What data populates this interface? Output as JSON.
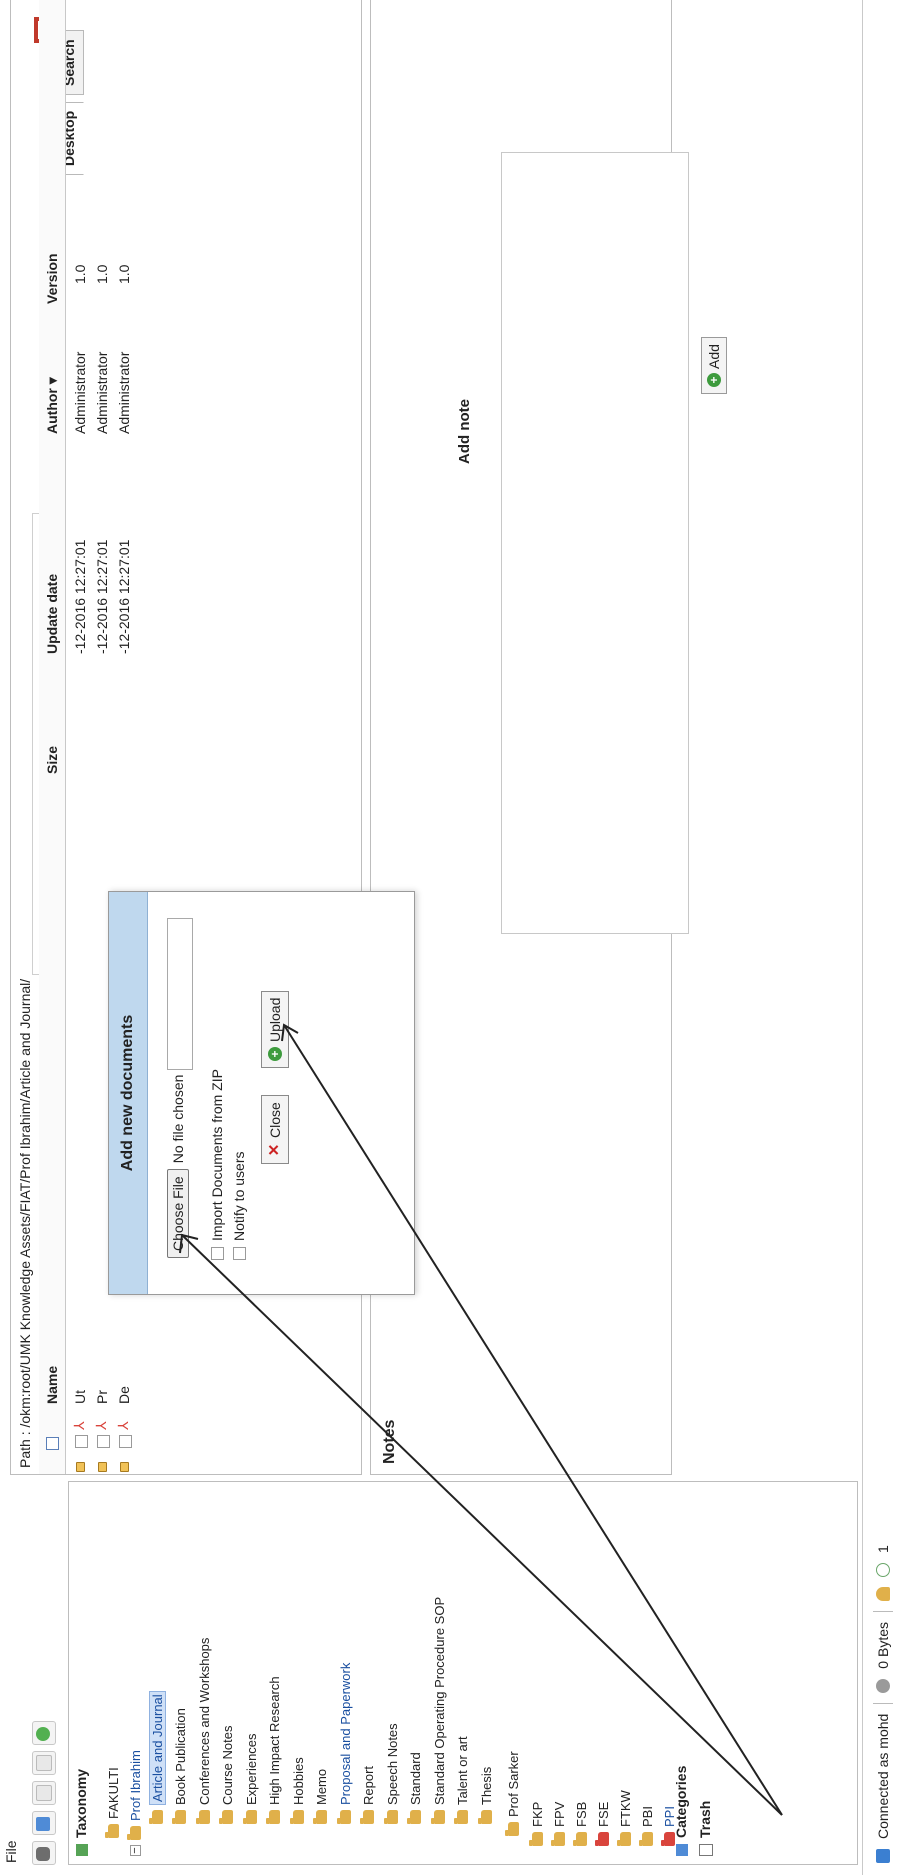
{
  "menu": {
    "file_label": "File"
  },
  "toolbar": {
    "tabs": [
      {
        "label": "Desktop"
      },
      {
        "label": "Search"
      }
    ]
  },
  "sidebar": {
    "taxonomy_label": "Taxonomy",
    "tree": {
      "fakulti": "FAKULTI",
      "prof_ibrahim": "Prof Ibrahim",
      "children": [
        "Article and Journal",
        "Book Publication",
        "Conferences and Workshops",
        "Course Notes",
        "Experiences",
        "High Impact Research",
        "Hobbies",
        "Memo",
        "Proposal and Paperwork",
        "Report",
        "Speech Notes",
        "Standard",
        "Standard Operating Procedure SOP",
        "Talent or art",
        "Thesis"
      ],
      "prof_sarker": "Prof Sarker",
      "faculties": [
        "FKP",
        "FPV",
        "FSB",
        "FSE",
        "FTKW",
        "PBI",
        "PPI"
      ]
    },
    "categories_label": "Categories",
    "trash_label": "Trash"
  },
  "status": {
    "connected": "Connected as mohd",
    "bytes": "0 Bytes",
    "count": "1"
  },
  "documents": {
    "path": "Path : /okm:root/UMK Knowledge Assets/FIAT/Prof Ibrahim/Article and Journal/",
    "headers": {
      "name": "Name",
      "size": "Size",
      "update_date": "Update date",
      "author": "Author ▾",
      "version": "Version"
    },
    "rows": [
      {
        "name": "Ut",
        "date": "-12-2016 12:27:01",
        "author": "Administrator",
        "version": "1.0"
      },
      {
        "name": "Pr",
        "date": "-12-2016 12:27:01",
        "author": "Administrator",
        "version": "1.0"
      },
      {
        "name": "De",
        "date": "-12-2016 12:27:01",
        "author": "Administrator",
        "version": "1.0"
      }
    ]
  },
  "notes": {
    "title": "Notes",
    "add_note_label": "Add note",
    "add_button": "Add"
  },
  "dialog": {
    "title": "Add new documents",
    "choose_file": "Choose File",
    "no_file": "No file chosen",
    "import_zip": "Import Documents from ZIP",
    "notify_users": "Notify to users",
    "close": "Close",
    "upload": "Upload"
  },
  "colors": {
    "dialog_header": "#bfd8ee",
    "folder": "#e0b04a",
    "folder_red": "#d9443c",
    "link": "#1a4fa0",
    "add_green": "#3d9b3d"
  }
}
